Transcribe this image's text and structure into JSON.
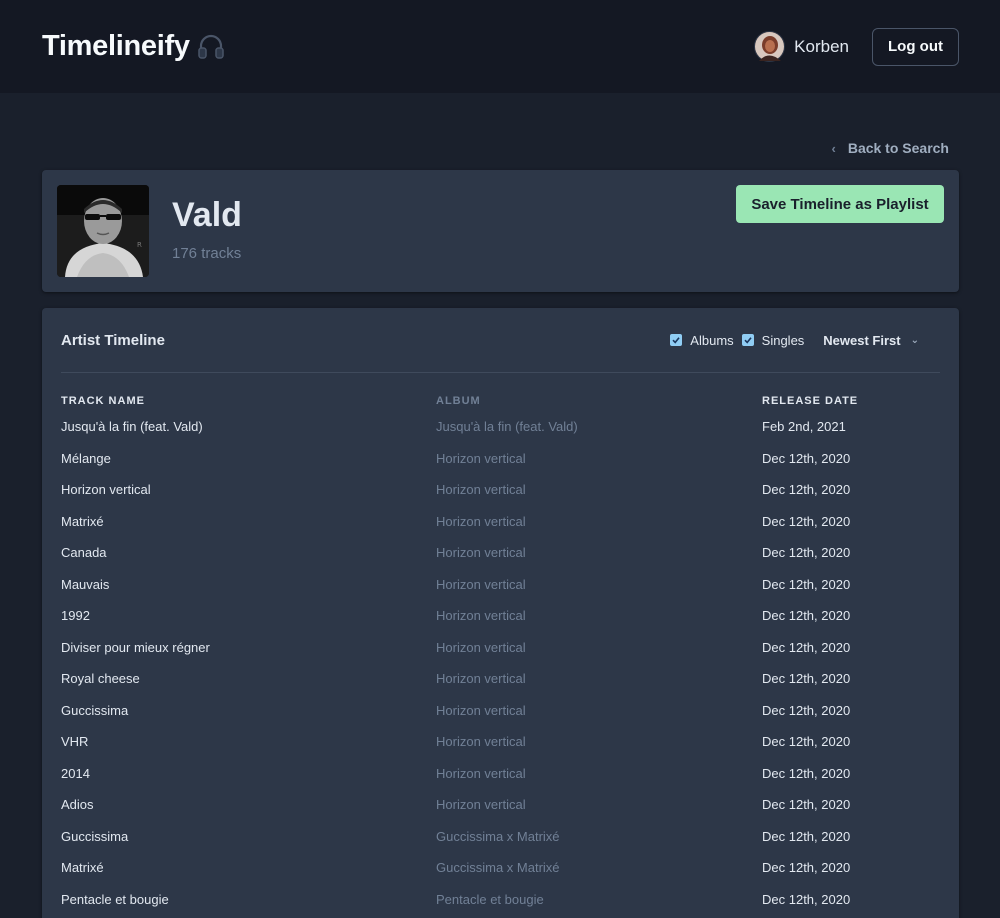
{
  "app": {
    "title": "Timelineify",
    "brand_icon": "headphones-icon"
  },
  "user": {
    "name": "Korben",
    "logout_label": "Log out"
  },
  "nav": {
    "back_label": "Back to Search"
  },
  "artist": {
    "name": "Vald",
    "track_count": "176 tracks",
    "save_label": "Save Timeline as Playlist"
  },
  "timeline": {
    "title": "Artist Timeline",
    "filters": {
      "albums_label": "Albums",
      "albums_checked": true,
      "singles_label": "Singles",
      "singles_checked": true
    },
    "sort_label": "Newest First",
    "columns": [
      "TRACK NAME",
      "ALBUM",
      "RELEASE DATE"
    ],
    "rows": [
      {
        "track": "Jusqu'à la fin (feat. Vald)",
        "album": "Jusqu'à la fin (feat. Vald)",
        "date": "Feb 2nd, 2021"
      },
      {
        "track": "Mélange",
        "album": "Horizon vertical",
        "date": "Dec 12th, 2020"
      },
      {
        "track": "Horizon vertical",
        "album": "Horizon vertical",
        "date": "Dec 12th, 2020"
      },
      {
        "track": "Matrixé",
        "album": "Horizon vertical",
        "date": "Dec 12th, 2020"
      },
      {
        "track": "Canada",
        "album": "Horizon vertical",
        "date": "Dec 12th, 2020"
      },
      {
        "track": "Mauvais",
        "album": "Horizon vertical",
        "date": "Dec 12th, 2020"
      },
      {
        "track": "1992",
        "album": "Horizon vertical",
        "date": "Dec 12th, 2020"
      },
      {
        "track": "Diviser pour mieux régner",
        "album": "Horizon vertical",
        "date": "Dec 12th, 2020"
      },
      {
        "track": "Royal cheese",
        "album": "Horizon vertical",
        "date": "Dec 12th, 2020"
      },
      {
        "track": "Guccissima",
        "album": "Horizon vertical",
        "date": "Dec 12th, 2020"
      },
      {
        "track": "VHR",
        "album": "Horizon vertical",
        "date": "Dec 12th, 2020"
      },
      {
        "track": "2014",
        "album": "Horizon vertical",
        "date": "Dec 12th, 2020"
      },
      {
        "track": "Adios",
        "album": "Horizon vertical",
        "date": "Dec 12th, 2020"
      },
      {
        "track": "Guccissima",
        "album": "Guccissima x Matrixé",
        "date": "Dec 12th, 2020"
      },
      {
        "track": "Matrixé",
        "album": "Guccissima x Matrixé",
        "date": "Dec 12th, 2020"
      },
      {
        "track": "Pentacle et bougie",
        "album": "Pentacle et bougie",
        "date": "Dec 12th, 2020"
      }
    ]
  },
  "colors": {
    "background": "#1a202c",
    "card": "#2d3748",
    "accent_green": "#9ae6b4",
    "checkbox_blue": "#90cdf4"
  }
}
